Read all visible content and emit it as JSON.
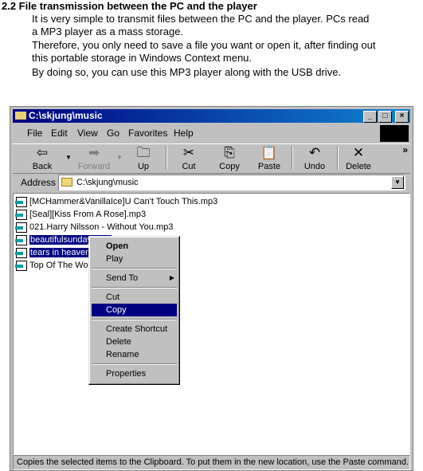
{
  "doc": {
    "heading": "2.2    File transmission between the PC and the player",
    "paragraphs": [
      "It is very simple to transmit files between the PC and the player.    PCs read",
      "a MP3 player as a mass storage.",
      "Therefore, you only need to save a file you want or open it, after finding out",
      "this portable storage in Windows Context menu.",
      "By doing so, you can use this MP3 player along with the USB drive."
    ]
  },
  "window": {
    "title": "C:\\skjung\\music",
    "controls": [
      "_",
      "□",
      "×"
    ],
    "menu": [
      "File",
      "Edit",
      "View",
      "Go",
      "Favorites",
      "Help"
    ],
    "toolbar": [
      {
        "label": "Back",
        "icon": "⇦"
      },
      {
        "label": "Forward",
        "icon": "➡"
      },
      {
        "label": "Up",
        "icon": "🗀"
      },
      {
        "label": "Cut",
        "icon": "✂"
      },
      {
        "label": "Copy",
        "icon": "⎘"
      },
      {
        "label": "Paste",
        "icon": "📋"
      },
      {
        "label": "Undo",
        "icon": "↶"
      },
      {
        "label": "Delete",
        "icon": "✕"
      }
    ],
    "more": "»",
    "address_label": "Address",
    "address_value": "C:\\skjung\\music",
    "files": [
      {
        "name": "[MCHammer&VanillaIce]U Can't Touch This.mp3",
        "selected": false
      },
      {
        "name": "[Seal][Kiss From A Rose].mp3",
        "selected": false
      },
      {
        "name": "021.Harry Nilsson - Without You.mp3",
        "selected": false
      },
      {
        "name": "beautifulsunday.mp3",
        "selected": true
      },
      {
        "name": "tears in heaven.mp3",
        "selected": true
      },
      {
        "name": "Top Of The World.mp3",
        "selected": false
      }
    ],
    "context_menu": [
      "Open",
      "Play",
      "Send To",
      "Cut",
      "Copy",
      "Create Shortcut",
      "Delete",
      "Rename",
      "Properties"
    ],
    "highlighted": "Copy",
    "status": "Copies the selected items to the Clipboard. To put them in the new location, use the Paste command."
  }
}
